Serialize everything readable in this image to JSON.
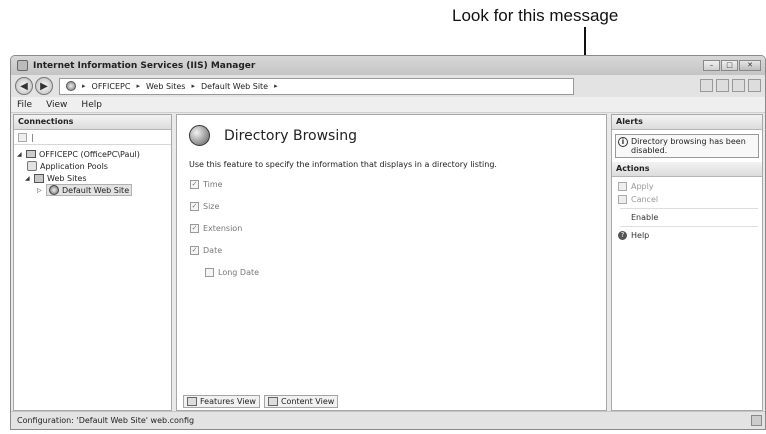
{
  "annotation": {
    "text": "Look for this message"
  },
  "window": {
    "title": "Internet Information Services (IIS) Manager"
  },
  "window_controls": {
    "minimize": "–",
    "maximize": "□",
    "close": "✕"
  },
  "nav": {
    "back": "◀",
    "forward": "▶"
  },
  "address": {
    "crumbs": [
      "OFFICEPC",
      "Web Sites",
      "Default Web Site"
    ],
    "separator": "▸"
  },
  "menu": [
    "File",
    "View",
    "Help"
  ],
  "connections": {
    "header": "Connections",
    "tree": [
      {
        "label": "OFFICEPC (OfficePC\\Paul)",
        "icon": "server-icon"
      },
      {
        "label": "Application Pools",
        "icon": "app-pool-icon"
      },
      {
        "label": "Web Sites",
        "icon": "web-sites-icon"
      },
      {
        "label": "Default Web Site",
        "icon": "globe-icon",
        "selected": true
      }
    ]
  },
  "feature": {
    "title": "Directory Browsing",
    "description": "Use this feature to specify the information that displays in a directory listing.",
    "options": [
      {
        "label": "Time",
        "checked": true
      },
      {
        "label": "Size",
        "checked": true
      },
      {
        "label": "Extension",
        "checked": true
      },
      {
        "label": "Date",
        "checked": true
      },
      {
        "label": "Long Date",
        "checked": false
      }
    ],
    "tabs": [
      "Features View",
      "Content View"
    ]
  },
  "alerts": {
    "header": "Alerts",
    "message": "Directory browsing has been disabled."
  },
  "actions": {
    "header": "Actions",
    "items": [
      {
        "label": "Apply",
        "enabled": false
      },
      {
        "label": "Cancel",
        "enabled": false
      },
      {
        "label": "Enable",
        "enabled": true
      },
      {
        "label": "Help",
        "enabled": true
      }
    ]
  },
  "status": {
    "text": "Configuration: 'Default Web Site' web.config"
  }
}
